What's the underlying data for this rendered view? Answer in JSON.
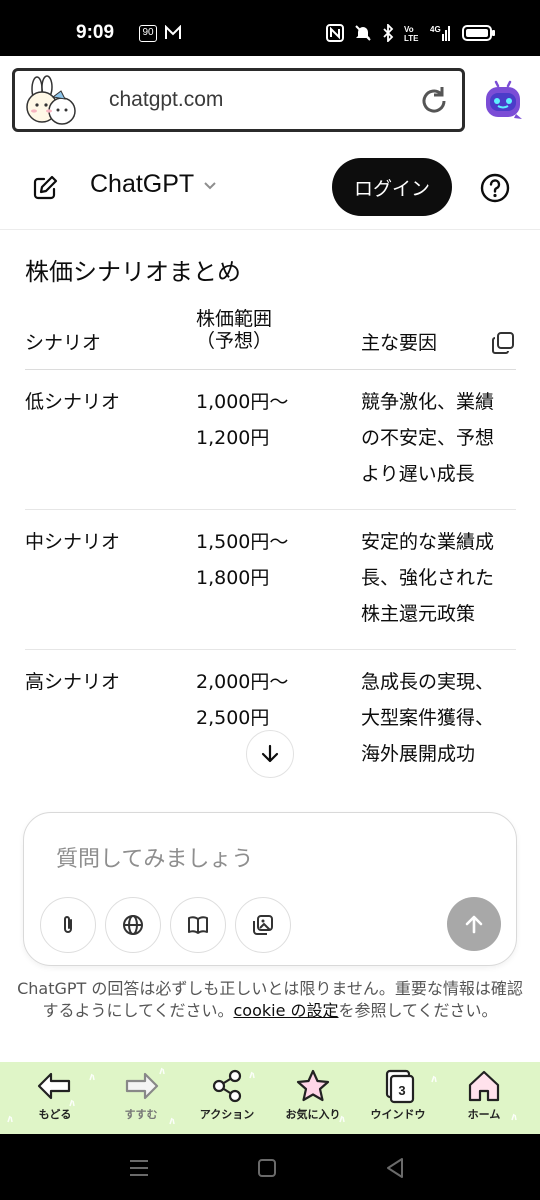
{
  "status_bar": {
    "time": "9:09",
    "badge": "90"
  },
  "browser": {
    "url": "chatgpt.com"
  },
  "header": {
    "brand": "ChatGPT",
    "login_label": "ログイン"
  },
  "content": {
    "title": "株価シナリオまとめ",
    "table": {
      "headers": [
        "シナリオ",
        "株価範囲\n（予想）",
        "主な要因"
      ],
      "header_line1": "株価範囲",
      "header_line2": "（予想）",
      "rows": [
        {
          "scenario": "低シナリオ",
          "range_1": "1,000円〜",
          "range_2": "1,200円",
          "factor_1": "競争激化、業績",
          "factor_2": "の不安定、予想",
          "factor_3": "より遅い成長"
        },
        {
          "scenario": "中シナリオ",
          "range_1": "1,500円〜",
          "range_2": "1,800円",
          "factor_1": "安定的な業績成",
          "factor_2": "長、強化された",
          "factor_3": "株主還元政策"
        },
        {
          "scenario": "高シナリオ",
          "range_1": "2,000円〜",
          "range_2": "2,500円",
          "factor_1": "急成長の実現、",
          "factor_2": "大型案件獲得、",
          "factor_3": "海外展開成功"
        }
      ]
    }
  },
  "composer": {
    "placeholder": "質問してみましょう"
  },
  "disclaimer": {
    "text_before": "ChatGPT の回答は必ずしも正しいとは限りません。重要な情報は確認するようにしてください。",
    "link": "cookie の設定",
    "text_after": "を参照してください。"
  },
  "bottom_toolbar": {
    "items": [
      {
        "label": "もどる",
        "icon": "back-arrow-icon"
      },
      {
        "label": "すすむ",
        "icon": "forward-arrow-icon"
      },
      {
        "label": "アクション",
        "icon": "share-icon"
      },
      {
        "label": "お気に入り",
        "icon": "star-icon"
      },
      {
        "label": "ウインドウ",
        "icon": "window-icon",
        "count": "3"
      },
      {
        "label": "ホーム",
        "icon": "home-icon"
      }
    ]
  },
  "colors": {
    "toolbar_bg": "#dff5c7",
    "login_bg": "#0d0d0d",
    "send_bg": "#a8a8a8"
  }
}
